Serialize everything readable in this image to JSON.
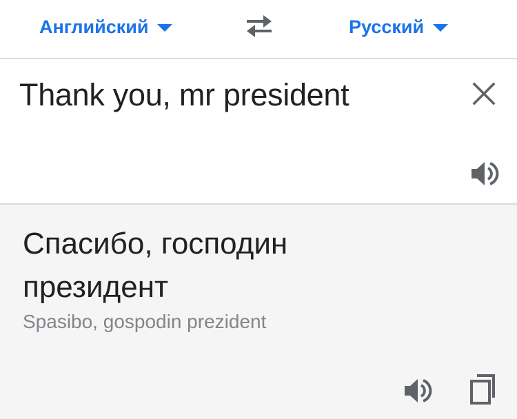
{
  "languages": {
    "source": "Английский",
    "target": "Русский"
  },
  "input": {
    "text": "Thank you, mr president"
  },
  "output": {
    "translation": "Спасибо, господин президент",
    "transliteration": "Spasibo, gospodin prezident"
  },
  "colors": {
    "accent": "#1a73e8",
    "text": "#202124",
    "muted": "#80868b",
    "icon": "#5f6368",
    "output_bg": "#f5f5f5",
    "divider": "#dadce0"
  },
  "icons": {
    "source_caret": "chevron-down-icon",
    "swap": "swap-languages-icon",
    "target_caret": "chevron-down-icon",
    "clear": "close-icon",
    "speak_source": "speaker-icon",
    "speak_output": "speaker-icon",
    "copy": "copy-icon"
  }
}
